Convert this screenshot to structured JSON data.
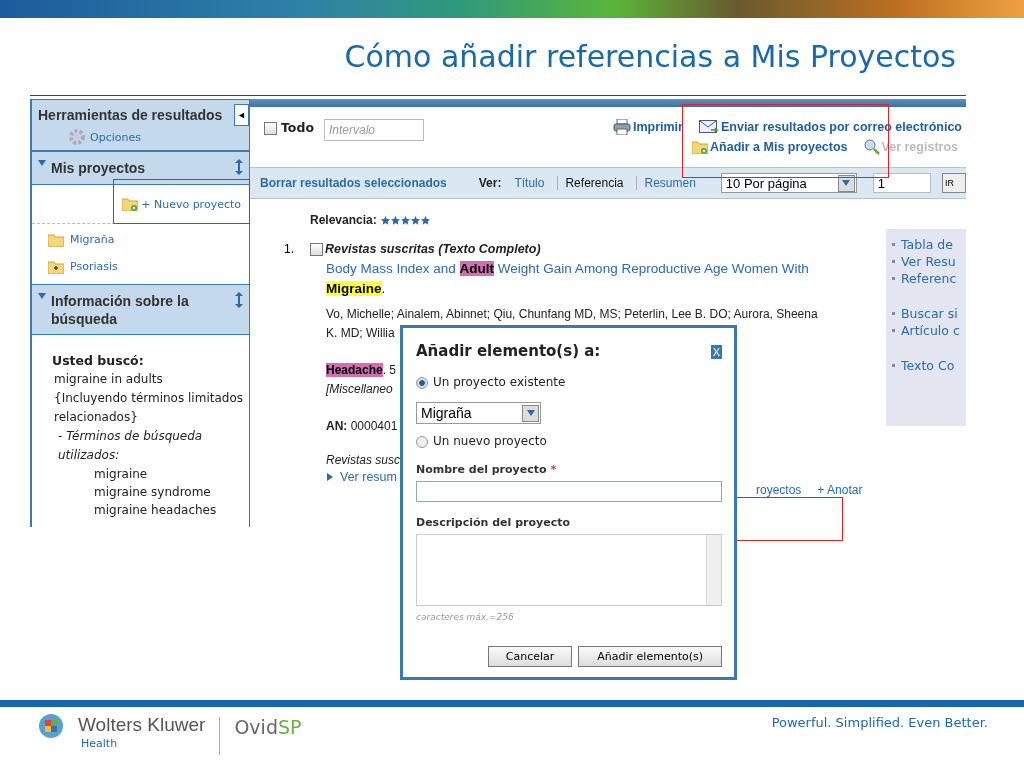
{
  "slide": {
    "title": "Cómo añadir referencias a Mis Proyectos",
    "company": "Wolters Kluwer",
    "division": "Health",
    "product": {
      "name": "Ovid",
      "suffix": "SP"
    },
    "tagline": "Powerful. Simplified. Even Better."
  },
  "sidebar": {
    "tools": {
      "title": "Herramientas de resultados",
      "collapse": "◄",
      "options": "Opciones"
    },
    "projects": {
      "title": "Mis proyectos",
      "expanded": true,
      "new_project": "+ Nuevo proyecto",
      "items": [
        {
          "label": "Migraña",
          "kind": "folder"
        },
        {
          "label": "Psoriasis",
          "kind": "folder-plus"
        }
      ]
    },
    "search_info": {
      "title": "Información sobre la búsqueda",
      "expanded": true,
      "heading": "Usted buscó:",
      "query": "migraine in adults",
      "note": "{Incluyendo términos limitados relacionados}",
      "terms_heading": "- Términos de búsqueda utilizados:",
      "terms": [
        "migraine",
        "migraine syndrome",
        "migraine headaches"
      ]
    }
  },
  "toolbar": {
    "select_all": {
      "label": "Todo",
      "checked": false
    },
    "range": {
      "placeholder": "Intervalo"
    },
    "actions": [
      {
        "label": "Imprimir",
        "kind": "print",
        "disabled": false
      },
      {
        "label": "Enviar resultados por correo electrónico",
        "kind": "email",
        "disabled": false
      },
      {
        "label": "Añadir a Mis proyectos",
        "kind": "project",
        "disabled": false
      },
      {
        "label": "Ver registros",
        "kind": "view",
        "disabled": true
      }
    ]
  },
  "view_bar": {
    "clear": "Borrar resultados seleccionados",
    "view_label": "Ver:",
    "views": [
      {
        "label": "Título",
        "selected": false
      },
      {
        "label": "Referencia",
        "selected": true
      },
      {
        "label": "Resumen",
        "selected": false
      }
    ],
    "per_page": "10 Por página",
    "page": "1",
    "go": "IR"
  },
  "results": {
    "relevance_label": "Relevancia:",
    "stars": 5,
    "items": [
      {
        "number": "1.",
        "checked": false,
        "source": "Revistas suscritas (Texto Completo)",
        "title": [
          {
            "text": "Body Mass Index and "
          },
          {
            "text": "Adult",
            "color": "#d070b0"
          },
          {
            "text": " Weight Gain Among Reproductive Age Women With "
          },
          {
            "text": "Migraine",
            "color": "#ffff44"
          }
        ],
        "title_end": ".",
        "authors": "Vo, Michelle; Ainalem, Abinnet; Qiu, Chunfang MD, MS; Peterlin, Lee B. DO; Aurora, Sheena",
        "authors_more": "K. MD; Willia",
        "journal": [
          {
            "text": "Headache",
            "color": "#d070b0"
          },
          {
            "text": ". 5"
          }
        ],
        "category": "[Miscellaneo",
        "accession": "**AN:** 0000401",
        "availability": "Revistas susc",
        "abstract_link": "Ver resum",
        "projects_link": "royectos",
        "annotate": "+ Anotar"
      }
    ],
    "side_links": [
      [
        "Tabla de",
        "Ver Resu",
        "Referenc"
      ],
      [
        "Buscar si",
        "Artículo c"
      ],
      [
        "Texto Co"
      ]
    ]
  },
  "dialog": {
    "title": "Añadir elemento(s) a:",
    "close": "X",
    "options": [
      {
        "label": "Un proyecto existente",
        "selected": true
      },
      {
        "label": "Un nuevo proyecto",
        "selected": false
      }
    ],
    "project": "Migraña",
    "name_label": "Nombre del proyecto",
    "required": "*",
    "description_label": "Descripción del proyecto",
    "limit": "caracteres máx.=256",
    "buttons": [
      {
        "label": "Cancelar"
      },
      {
        "label": "Añadir elemento(s)"
      }
    ]
  }
}
